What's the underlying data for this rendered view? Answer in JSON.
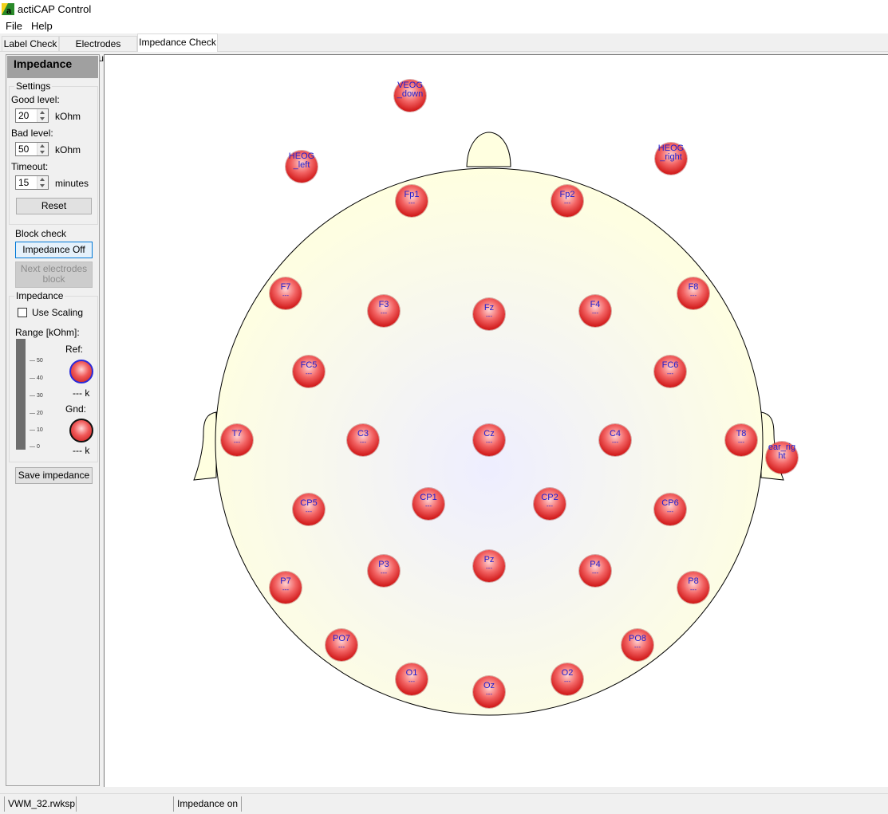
{
  "window": {
    "title": "actiCAP Control"
  },
  "menu": {
    "items": [
      "File",
      "Help"
    ]
  },
  "tabs": [
    {
      "label": "Label Check",
      "active": false
    },
    {
      "label": "Electrodes Groups",
      "active": false
    },
    {
      "label": "Impedance Check",
      "active": true
    }
  ],
  "panel": {
    "header": "Impedance",
    "settings": {
      "legend": "Settings",
      "good_label": "Good level:",
      "good_value": "20",
      "good_unit": "kOhm",
      "bad_label": "Bad level:",
      "bad_value": "50",
      "bad_unit": "kOhm",
      "timeout_label": "Timeout:",
      "timeout_value": "15",
      "timeout_unit": "minutes",
      "reset_label": "Reset"
    },
    "block_check": {
      "legend": "Block check",
      "impedance_button": "Impedance Off",
      "next_block_line1": "Next electrodes",
      "next_block_line2": "block"
    },
    "impedance": {
      "legend": "Impedance",
      "use_scaling_label": "Use Scaling",
      "use_scaling_checked": false,
      "range_label": "Range [kOhm]:",
      "ticks": [
        "50",
        "40",
        "30",
        "20",
        "10",
        "0"
      ],
      "ref_label": "Ref:",
      "ref_value": "--- k",
      "gnd_label": "Gnd:",
      "gnd_value": "--- k"
    },
    "save_label": "Save impedance"
  },
  "head": {
    "skin_color": "#ffffe0",
    "outline_color": "#000000"
  },
  "electrodes": [
    {
      "name": "VEOG",
      "name2": "_down",
      "imp": ""
    },
    {
      "name": "HEOG",
      "name2": "_left",
      "imp": ""
    },
    {
      "name": "HEOG",
      "name2": "_right",
      "imp": ""
    },
    {
      "name": "Fp1",
      "imp": "---"
    },
    {
      "name": "Fp2",
      "imp": "---"
    },
    {
      "name": "F7",
      "imp": "---"
    },
    {
      "name": "F3",
      "imp": "---"
    },
    {
      "name": "Fz",
      "imp": "---"
    },
    {
      "name": "F4",
      "imp": "---"
    },
    {
      "name": "F8",
      "imp": "---"
    },
    {
      "name": "FC5",
      "imp": "---"
    },
    {
      "name": "FC6",
      "imp": "---"
    },
    {
      "name": "T7",
      "imp": "---"
    },
    {
      "name": "C3",
      "imp": "---"
    },
    {
      "name": "Cz",
      "imp": "---"
    },
    {
      "name": "C4",
      "imp": "---"
    },
    {
      "name": "T8",
      "imp": "---"
    },
    {
      "name": "ear_rig",
      "name2": "ht",
      "imp": ""
    },
    {
      "name": "CP5",
      "imp": "---"
    },
    {
      "name": "CP1",
      "imp": "---"
    },
    {
      "name": "CP2",
      "imp": "---"
    },
    {
      "name": "CP6",
      "imp": "---"
    },
    {
      "name": "P7",
      "imp": "---"
    },
    {
      "name": "P3",
      "imp": "---"
    },
    {
      "name": "Pz",
      "imp": "---"
    },
    {
      "name": "P4",
      "imp": "---"
    },
    {
      "name": "P8",
      "imp": "---"
    },
    {
      "name": "PO7",
      "imp": "---"
    },
    {
      "name": "PO8",
      "imp": "---"
    },
    {
      "name": "O1",
      "imp": "---"
    },
    {
      "name": "Oz",
      "imp": "---"
    },
    {
      "name": "O2",
      "imp": "---"
    }
  ],
  "status": {
    "file": "VWM_32.rwksp",
    "middle": "",
    "state": "Impedance on"
  }
}
